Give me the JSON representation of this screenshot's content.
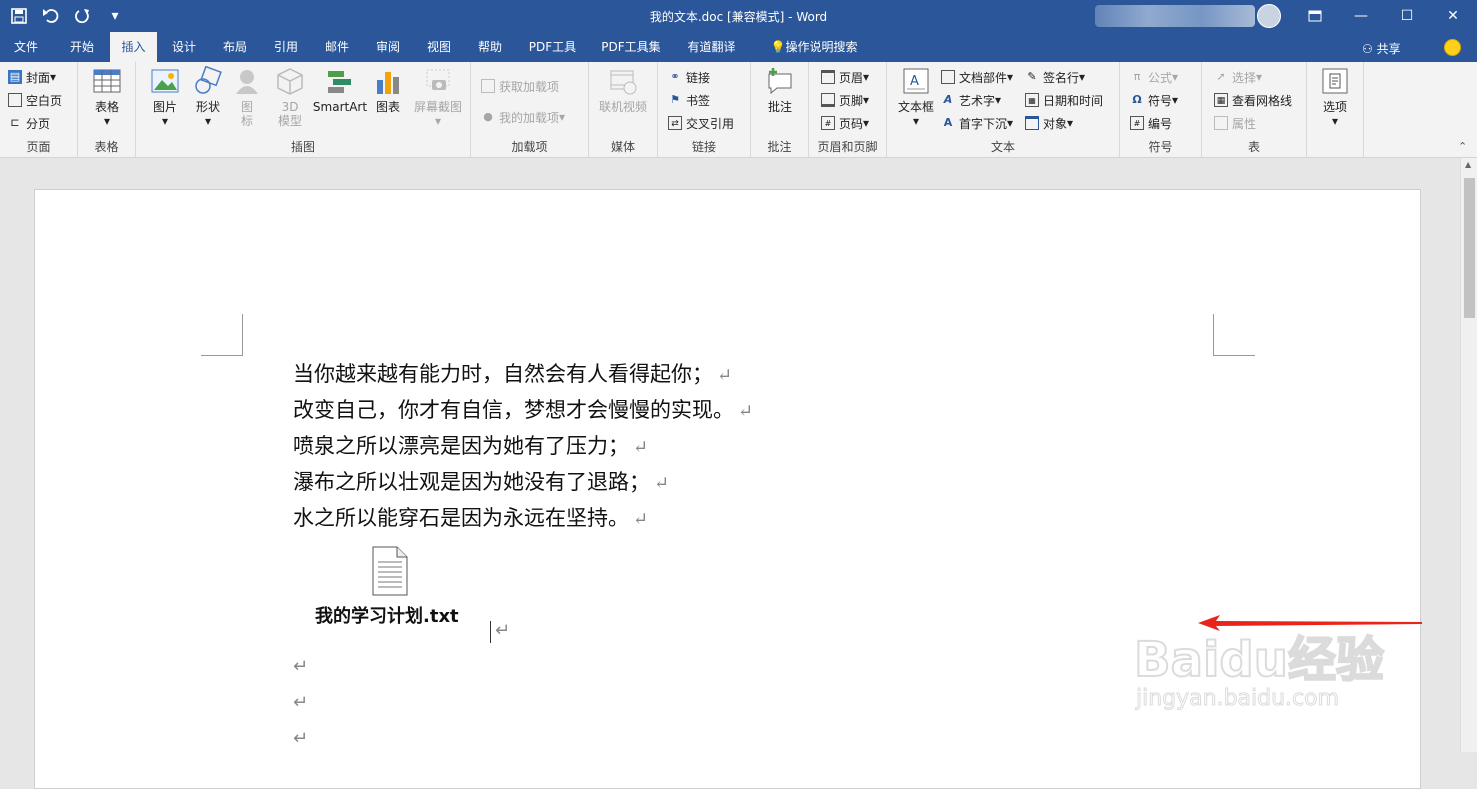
{
  "window": {
    "title": "我的文本.doc [兼容模式]  -  Word",
    "share_label": "共享"
  },
  "tabs": [
    "文件",
    "开始",
    "插入",
    "设计",
    "布局",
    "引用",
    "邮件",
    "审阅",
    "视图",
    "帮助",
    "PDF工具",
    "PDF工具集",
    "有道翻译",
    "操作说明搜索"
  ],
  "active_tab": "插入",
  "ribbon": {
    "pages": {
      "cover": "封面",
      "blank": "空白页",
      "break": "分页",
      "label": "页面"
    },
    "tables": {
      "table": "表格",
      "label": "表格"
    },
    "illustrations": {
      "picture": "图片",
      "shapes": "形状",
      "icons": "图标",
      "model3d": "3D模型",
      "smartart": "SmartArt",
      "chart": "图表",
      "screenshot": "屏幕截图",
      "label": "插图"
    },
    "addins": {
      "get": "获取加载项",
      "mine": "我的加载项",
      "label": "加载项"
    },
    "media": {
      "video": "联机视频",
      "label": "媒体"
    },
    "links": {
      "link": "链接",
      "bookmark": "书签",
      "crossref": "交叉引用",
      "label": "链接"
    },
    "comments": {
      "comment": "批注",
      "label": "批注"
    },
    "headerfooter": {
      "header": "页眉",
      "footer": "页脚",
      "pagenum": "页码",
      "label": "页眉和页脚"
    },
    "text": {
      "textbox": "文本框",
      "parts": "文档部件",
      "wordart": "艺术字",
      "dropcap": "首字下沉",
      "signature": "签名行",
      "datetime": "日期和时间",
      "object": "对象",
      "label": "文本"
    },
    "symbols": {
      "equation": "公式",
      "symbol": "符号",
      "number": "编号",
      "label": "符号"
    },
    "table2": {
      "select": "选择",
      "gridlines": "查看网格线",
      "properties": "属性",
      "label": "表"
    },
    "options": {
      "options": "选项"
    }
  },
  "document": {
    "lines": [
      "当你越来越有能力时，自然会有人看得起你；",
      "改变自己，你才有自信，梦想才会慢慢的实现。",
      "喷泉之所以漂亮是因为她有了压力；",
      "瀑布之所以壮观是因为她没有了退路；",
      "水之所以能穿石是因为永远在坚持。"
    ],
    "attachment_label": "我的学习计划.txt",
    "paragraph_mark": "↵"
  },
  "watermark": {
    "brand": "Baidu经验",
    "url": "jingyan.baidu.com"
  },
  "colors": {
    "accent": "#2b579a",
    "arrow": "#e8251b"
  }
}
